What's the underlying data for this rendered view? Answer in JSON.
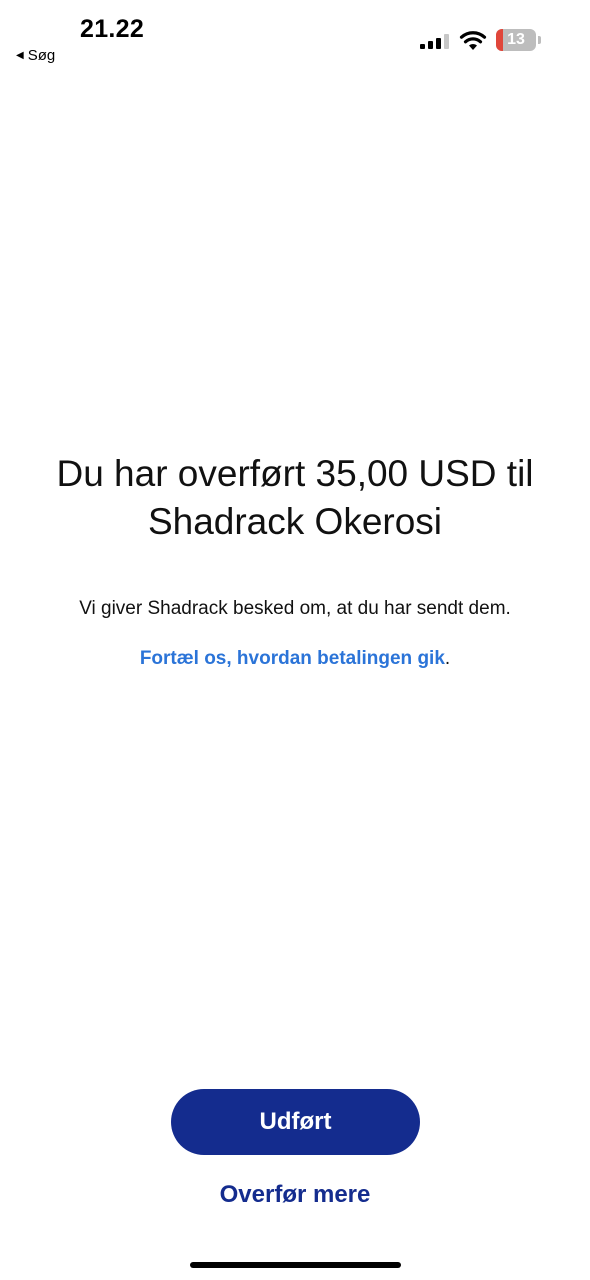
{
  "status_bar": {
    "time": "21.22",
    "back_label": "Søg",
    "battery_level": "13",
    "battery_fraction": 0.13,
    "battery_low_color": "#e0463a",
    "signal_bars_active": 3,
    "signal_bars_total": 4,
    "icons": [
      "signal-icon",
      "wifi-icon",
      "battery-icon"
    ]
  },
  "confirmation": {
    "headline": "Du har overført 35,00 USD til Shadrack Okerosi",
    "message": "Vi giver Shadrack besked om, at du har sendt dem.",
    "feedback_link": "Fortæl os, hvordan betalingen gik",
    "feedback_suffix": "."
  },
  "actions": {
    "done_label": "Udført",
    "transfer_more_label": "Overfør mere"
  },
  "colors": {
    "primary": "#142c8e",
    "link": "#2b74d8",
    "background": "#ffffff"
  }
}
